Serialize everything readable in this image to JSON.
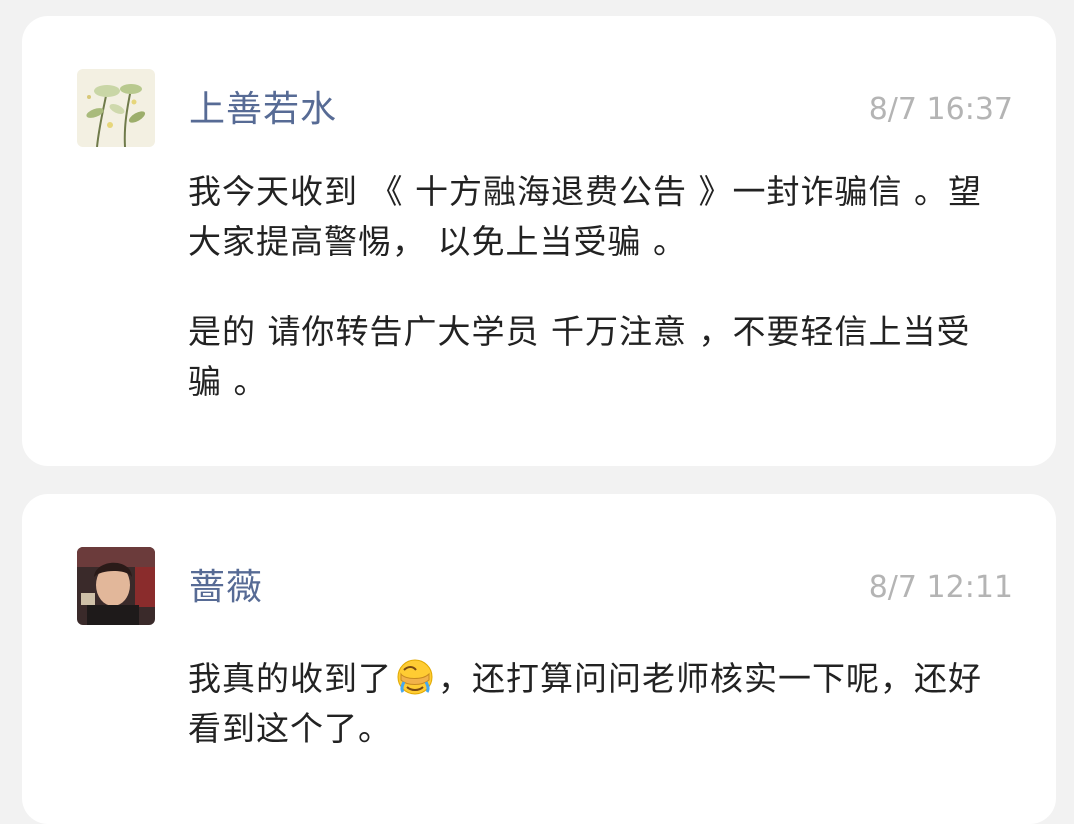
{
  "colors": {
    "name": "#576b95",
    "time": "#b4b4b4",
    "text": "#222222",
    "card": "#ffffff",
    "background": "#f2f2f2"
  },
  "comments": [
    {
      "user": "上善若水",
      "time": "8/7 16:37",
      "avatar_icon": "plant-illustration-avatar",
      "messages": [
        "我今天收到 《 十方融海退费公告 》一封诈骗信 。望大家提高警惕， 以免上当受骗 。",
        "是的 请你转告广大学员 千万注意 ，不要轻信上当受骗 。"
      ]
    },
    {
      "user": "蔷薇",
      "time": "8/7 12:11",
      "avatar_icon": "person-photo-avatar",
      "message_before_emoji": "我真的收到了",
      "emoji": "facepalm-crying-emoji",
      "message_after_emoji": "，还打算问问老师核实一下呢，还好看到这个了。"
    }
  ]
}
